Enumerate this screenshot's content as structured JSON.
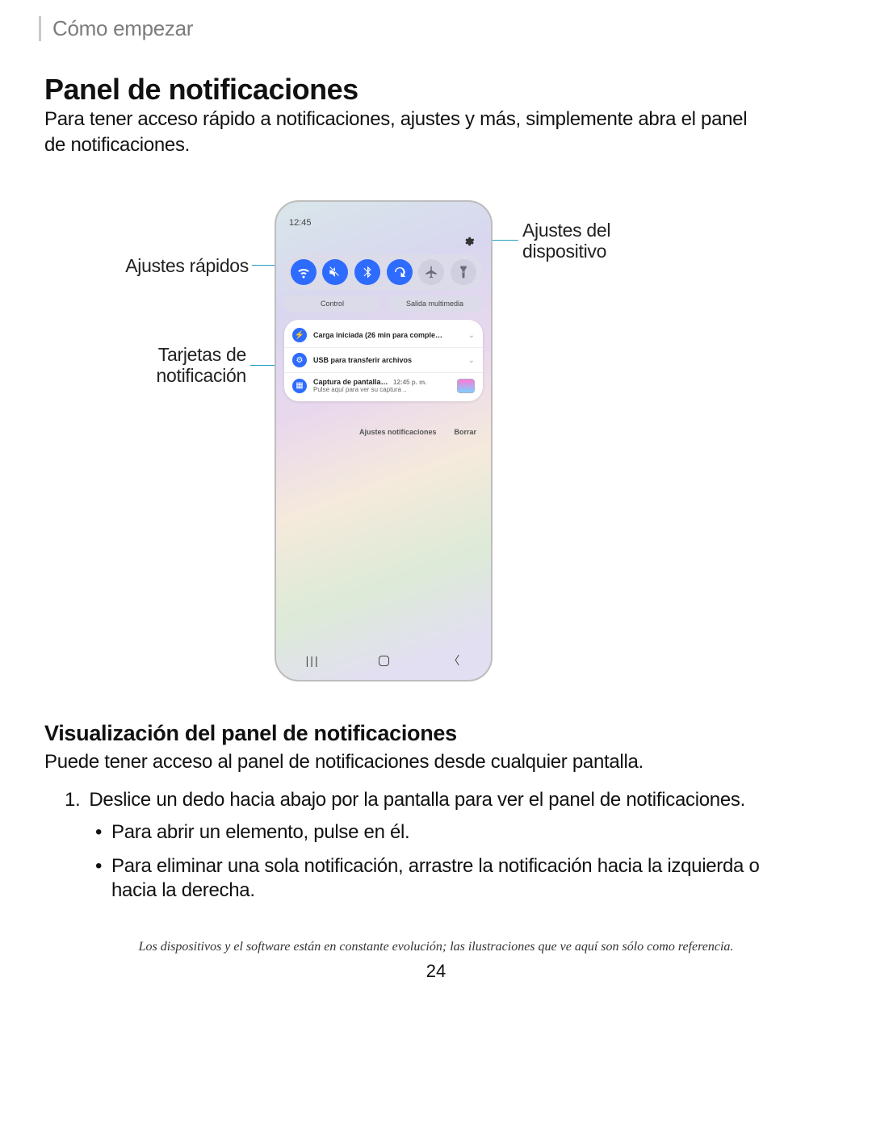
{
  "breadcrumb": "Cómo empezar",
  "heading": "Panel de notificaciones",
  "intro": "Para tener acceso rápido a notificaciones, ajustes y más, simplemente abra el panel de notificaciones.",
  "callouts": {
    "quick_settings": "Ajustes rápidos",
    "device_settings_l1": "Ajustes del",
    "device_settings_l2": "dispositivo",
    "cards_l1": "Tarjetas de",
    "cards_l2": "notificación"
  },
  "phone": {
    "time": "12:45",
    "qs_icons": [
      "wifi",
      "mute",
      "bluetooth",
      "rotate",
      "airplane",
      "flashlight"
    ],
    "pill_control": "Control",
    "pill_media": "Salida multimedia",
    "cards": [
      {
        "icon": "bolt",
        "title": "Carga iniciada (26 min para comple…",
        "sub": "",
        "time": "",
        "chevron": true
      },
      {
        "icon": "gear",
        "title": "USB para transferir archivos",
        "sub": "",
        "time": "",
        "chevron": true
      },
      {
        "icon": "image",
        "title": "Captura de pantalla…",
        "sub": "Pulse aquí para ver su captura ..",
        "time": "12:45 p. m.",
        "chevron": false,
        "thumb": true
      }
    ],
    "action_settings": "Ajustes notificaciones",
    "action_clear": "Borrar"
  },
  "subheading": "Visualización del panel de notificaciones",
  "subtext": "Puede tener acceso al panel de notificaciones desde cualquier pantalla.",
  "step_num": "1.",
  "step1": "Deslice un dedo hacia abajo por la pantalla para ver el panel de notificaciones.",
  "bullets": [
    "Para abrir un elemento, pulse en él.",
    "Para eliminar una sola notificación, arrastre la notificación hacia la izquierda o hacia la derecha."
  ],
  "disclaimer": "Los dispositivos y el software están en constante evolución; las ilustraciones que ve aquí son sólo como referencia.",
  "page": "24"
}
